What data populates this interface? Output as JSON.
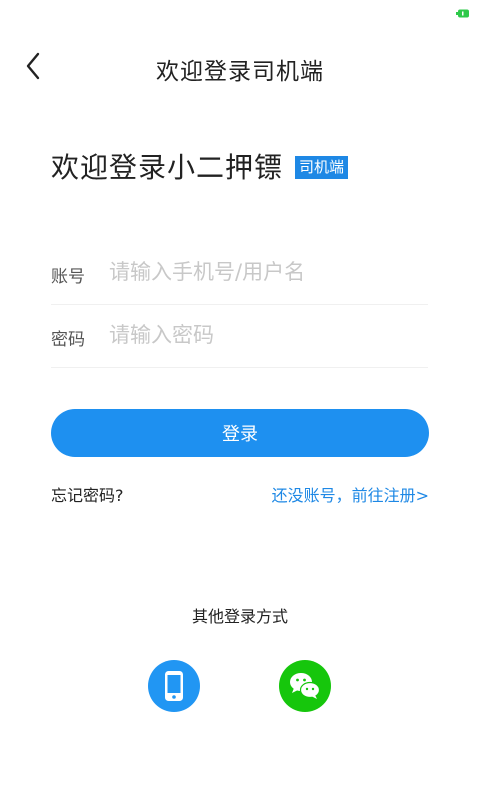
{
  "nav": {
    "title": "欢迎登录司机端"
  },
  "welcome": {
    "title": "欢迎登录小二押镖",
    "badge": "司机端"
  },
  "form": {
    "account_label": "账号",
    "account_placeholder": "请输入手机号/用户名",
    "password_label": "密码",
    "password_placeholder": "请输入密码"
  },
  "actions": {
    "login_label": "登录",
    "forgot_label": "忘记密码?",
    "register_label": "还没账号，前往注册>"
  },
  "other_login": {
    "label": "其他登录方式",
    "options": [
      {
        "name": "phone",
        "icon": "phone-icon",
        "color": "#2196f3"
      },
      {
        "name": "wechat",
        "icon": "wechat-icon",
        "color": "#16c60c"
      }
    ]
  },
  "colors": {
    "accent": "#1e88e5",
    "button": "#1e90f0",
    "wechat": "#16c60c"
  }
}
